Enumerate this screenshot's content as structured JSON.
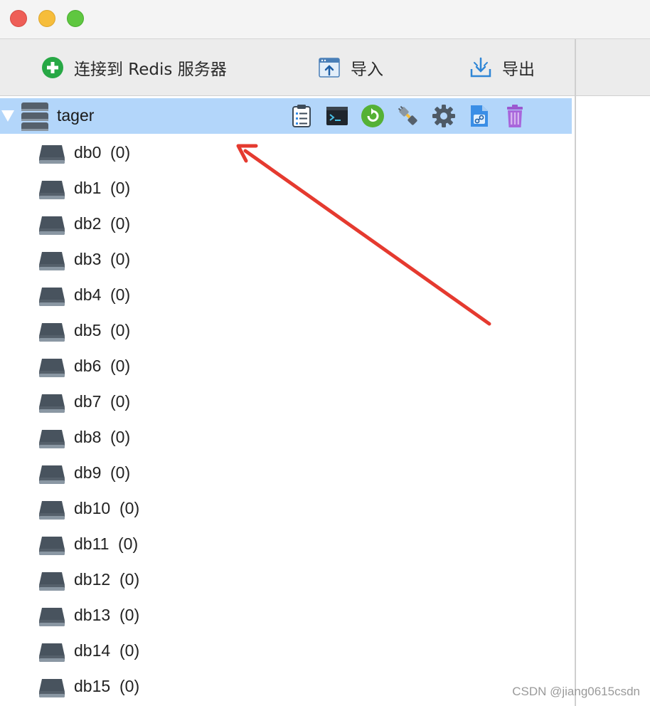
{
  "window": {
    "controls": [
      "close",
      "minimize",
      "maximize"
    ]
  },
  "toolbar": {
    "connect_label": "连接到 Redis 服务器",
    "import_label": "导入",
    "export_label": "导出"
  },
  "server": {
    "name": "tager",
    "actions": [
      "clipboard-icon",
      "console-icon",
      "reload-icon",
      "plug-icon",
      "gear-icon",
      "file-link-icon",
      "trash-icon"
    ]
  },
  "databases": [
    {
      "name": "db0",
      "count": "(0)"
    },
    {
      "name": "db1",
      "count": "(0)"
    },
    {
      "name": "db2",
      "count": "(0)"
    },
    {
      "name": "db3",
      "count": "(0)"
    },
    {
      "name": "db4",
      "count": "(0)"
    },
    {
      "name": "db5",
      "count": "(0)"
    },
    {
      "name": "db6",
      "count": "(0)"
    },
    {
      "name": "db7",
      "count": "(0)"
    },
    {
      "name": "db8",
      "count": "(0)"
    },
    {
      "name": "db9",
      "count": "(0)"
    },
    {
      "name": "db10",
      "count": "(0)"
    },
    {
      "name": "db11",
      "count": "(0)"
    },
    {
      "name": "db12",
      "count": "(0)"
    },
    {
      "name": "db13",
      "count": "(0)"
    },
    {
      "name": "db14",
      "count": "(0)"
    },
    {
      "name": "db15",
      "count": "(0)"
    }
  ],
  "watermark": "CSDN @jiang0615csdn",
  "colors": {
    "selection": "#b3d6fa",
    "annotation_arrow": "#e53a2f",
    "connect_icon": "#27a845"
  }
}
